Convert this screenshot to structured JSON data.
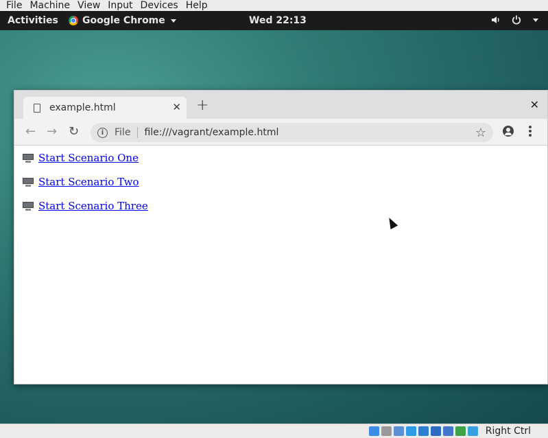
{
  "vbox_menu": [
    "File",
    "Machine",
    "View",
    "Input",
    "Devices",
    "Help"
  ],
  "gnome": {
    "activities": "Activities",
    "app_name": "Google Chrome",
    "clock": "Wed 22:13"
  },
  "browser": {
    "tab_title": "example.html",
    "omnibox": {
      "scheme_label": "File",
      "url": "file:///vagrant/example.html"
    }
  },
  "page": {
    "links": [
      {
        "label": "Start Scenario One"
      },
      {
        "label": "Start Scenario Two"
      },
      {
        "label": "Start Scenario Three"
      }
    ]
  },
  "vbox_status": {
    "host_key": "Right Ctrl",
    "icon_colors": [
      "#3a8ee6",
      "#9a9a9a",
      "#5b8fd6",
      "#2f9be6",
      "#2f7fd1",
      "#2e6cc2",
      "#4476c9",
      "#3da34a",
      "#39a0e0"
    ]
  },
  "colors": {
    "link": "#0000ee",
    "gnome_bar": "#1b1b1b",
    "desktop": "#2f7a74"
  }
}
